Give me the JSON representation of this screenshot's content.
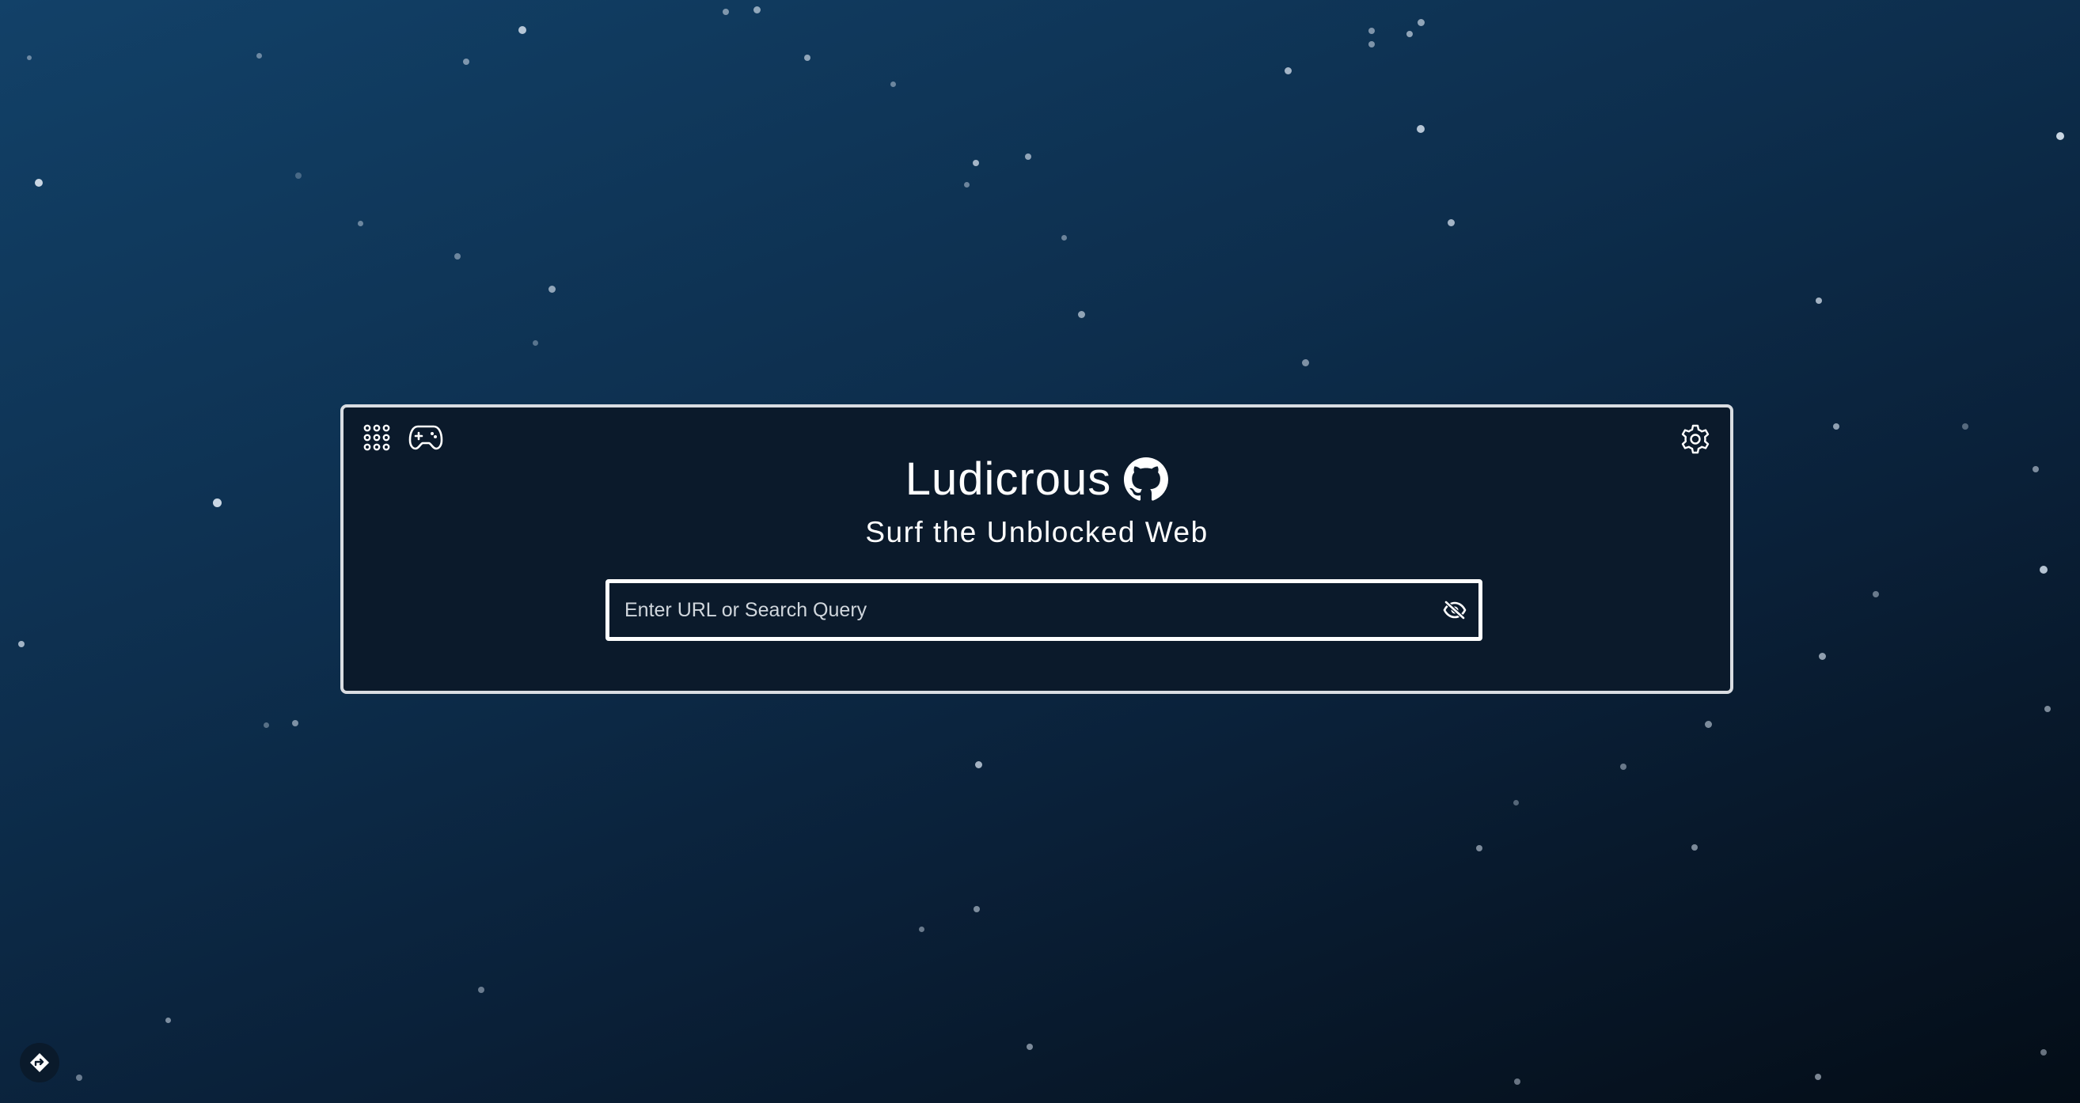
{
  "app": {
    "title": "Ludicrous",
    "subtitle": "Surf the Unblocked Web"
  },
  "search": {
    "placeholder": "Enter URL or Search Query",
    "value": ""
  },
  "icons": {
    "apps": "apps-grid-icon",
    "games": "gamepad-icon",
    "github": "github-icon",
    "settings": "gear-icon",
    "visibility": "eye-off-icon",
    "corner": "diamond-direction-icon"
  },
  "colors": {
    "background_start": "#124168",
    "background_end": "#040d17",
    "panel_background": "#0b1a2b",
    "panel_border": "#d9dde2",
    "text": "#ffffff"
  }
}
